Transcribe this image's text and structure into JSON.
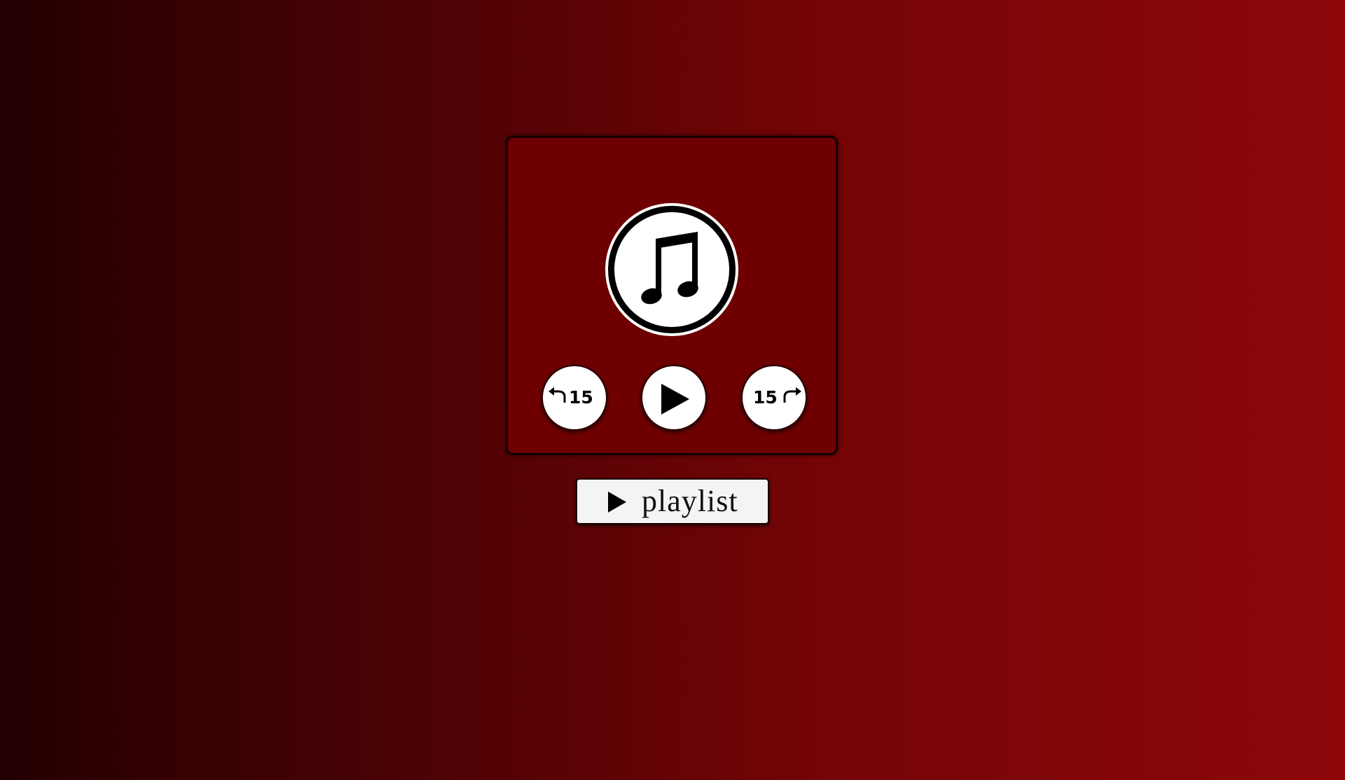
{
  "player": {
    "album_art_icon": "music-note-icon",
    "controls": {
      "rewind_icon": "rewind-arrow-icon",
      "rewind_label": "15",
      "play_icon": "play-icon",
      "forward_icon": "forward-arrow-icon",
      "forward_label": "15"
    }
  },
  "playlist_button": {
    "icon": "play-icon",
    "label": "playlist"
  },
  "colors": {
    "background_left": "#240002",
    "background_right": "#8e080a",
    "card": "#6e0002",
    "button": "#ffffff"
  }
}
